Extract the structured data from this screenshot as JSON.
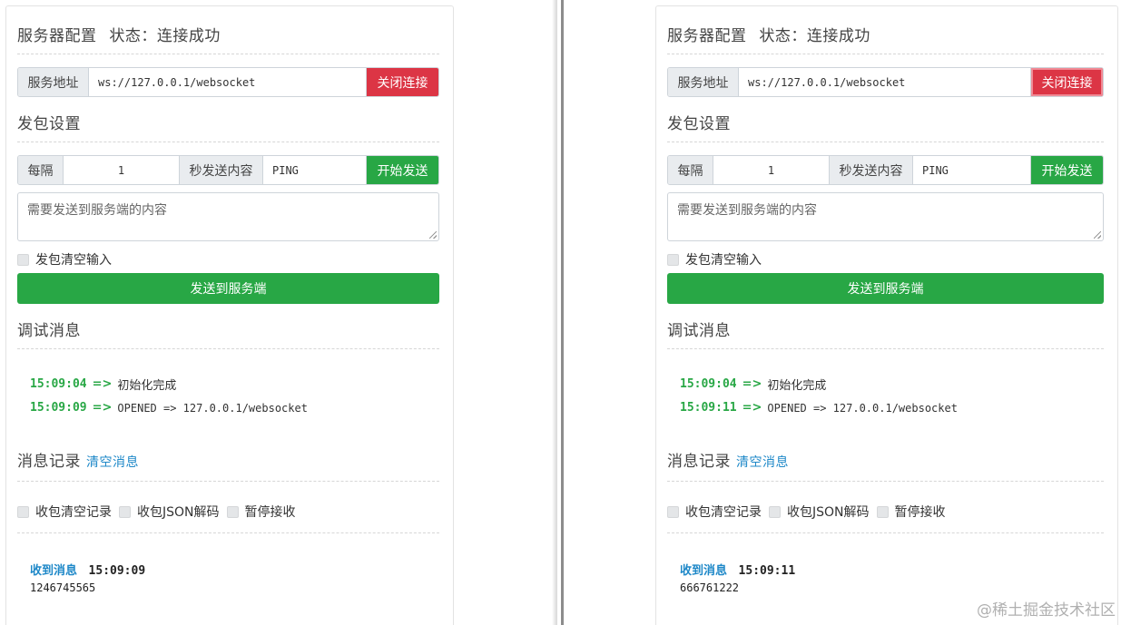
{
  "panels": [
    {
      "server_title": "服务器配置",
      "status_text": "状态：连接成功",
      "address_label": "服务地址",
      "address_value": "ws://127.0.0.1/websocket",
      "close_button": "关闭连接",
      "send_settings_title": "发包设置",
      "interval_label": "每隔",
      "interval_value": "1",
      "content_label": "秒发送内容",
      "content_value": "PING",
      "start_button": "开始发送",
      "textarea_placeholder": "需要发送到服务端的内容",
      "clear_input_label": "发包清空输入",
      "send_button": "发送到服务端",
      "debug_title": "调试消息",
      "debug_logs": [
        {
          "time": "15:09:04",
          "arrow": "=>",
          "text": "初始化完成"
        },
        {
          "time": "15:09:09",
          "arrow": "=>",
          "text": "OPENED => 127.0.0.1/websocket"
        }
      ],
      "records_title": "消息记录",
      "clear_messages_link": "清空消息",
      "options": [
        "收包清空记录",
        "收包JSON解码",
        "暂停接收"
      ],
      "received_label": "收到消息",
      "received_time": "15:09:09",
      "received_body": "1246745565"
    },
    {
      "server_title": "服务器配置",
      "status_text": "状态：连接成功",
      "address_label": "服务地址",
      "address_value": "ws://127.0.0.1/websocket",
      "close_button": "关闭连接",
      "send_settings_title": "发包设置",
      "interval_label": "每隔",
      "interval_value": "1",
      "content_label": "秒发送内容",
      "content_value": "PING",
      "start_button": "开始发送",
      "textarea_placeholder": "需要发送到服务端的内容",
      "clear_input_label": "发包清空输入",
      "send_button": "发送到服务端",
      "debug_title": "调试消息",
      "debug_logs": [
        {
          "time": "15:09:04",
          "arrow": "=>",
          "text": "初始化完成"
        },
        {
          "time": "15:09:11",
          "arrow": "=>",
          "text": "OPENED => 127.0.0.1/websocket"
        }
      ],
      "records_title": "消息记录",
      "clear_messages_link": "清空消息",
      "options": [
        "收包清空记录",
        "收包JSON解码",
        "暂停接收"
      ],
      "received_label": "收到消息",
      "received_time": "15:09:11",
      "received_body": "666761222"
    }
  ],
  "watermark": "@稀土掘金技术社区",
  "colors": {
    "danger": "#dc3545",
    "success": "#28a745",
    "link": "#1e88c8"
  }
}
